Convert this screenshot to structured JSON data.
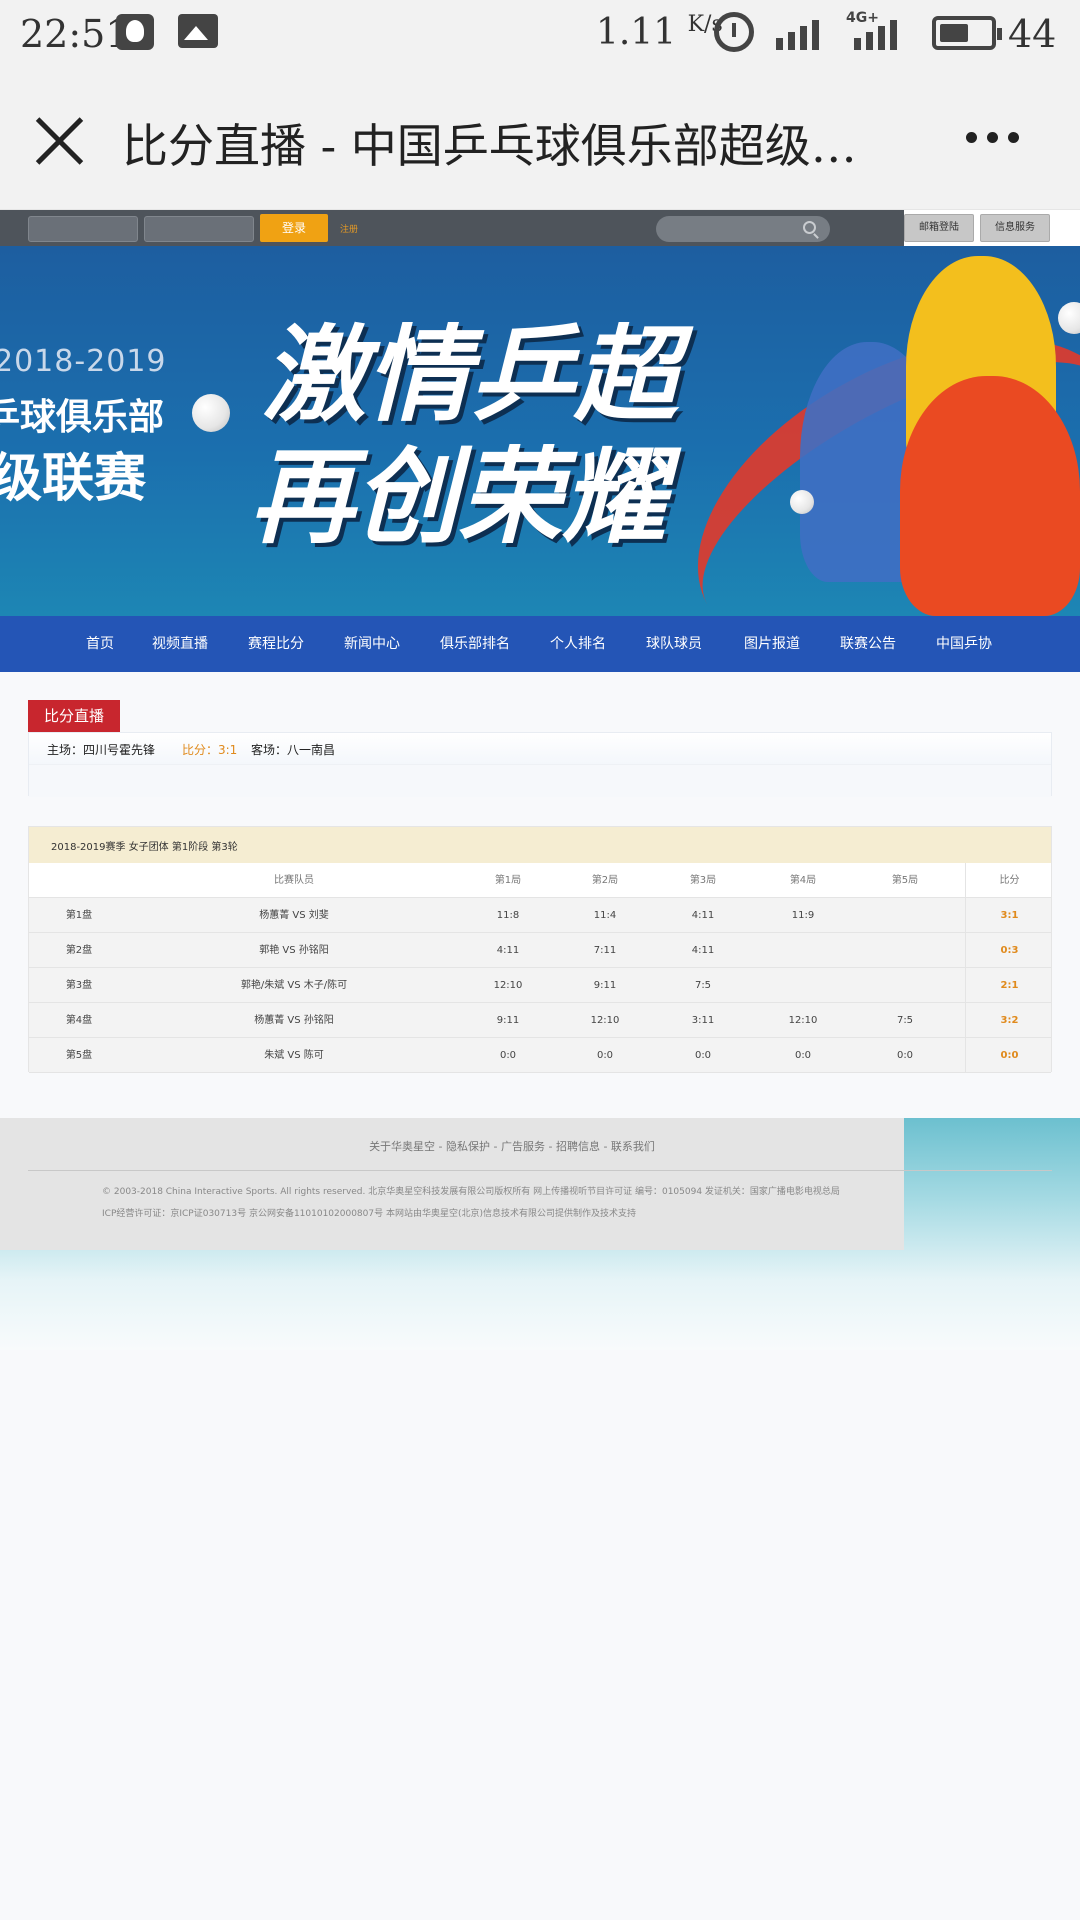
{
  "status_bar": {
    "time": "22:51",
    "net_speed": "1.11",
    "net_unit": "K/s",
    "network_type": "4G+",
    "battery": "44",
    "icons": [
      "qq-icon",
      "gallery-icon",
      "alarm-icon",
      "signal-icon",
      "signal-4g-icon",
      "battery-icon"
    ]
  },
  "browser": {
    "title": "比分直播 - 中国乒乓球俱乐部超级联赛",
    "close_icon": "close-icon",
    "more_icon": "more-icon"
  },
  "topnav": {
    "login_label": "登录",
    "register_label": "注册",
    "mail_label": "邮箱登陆",
    "info_label": "信息服务"
  },
  "banner": {
    "year": "2018-2019",
    "club_text": "乒球俱乐部",
    "league_text": "级联赛",
    "slogan_line1": "激情乒超",
    "slogan_line2": "再创荣耀"
  },
  "main_nav": [
    "首页",
    "视频直播",
    "赛程比分",
    "新闻中心",
    "俱乐部排名",
    "个人排名",
    "球队球员",
    "图片报道",
    "联赛公告",
    "中国乒协"
  ],
  "section": {
    "tag": "比分直播",
    "home": "主场：四川号霍先锋",
    "score": "比分：3:1",
    "away": "客场：八一南昌"
  },
  "scorecard": {
    "title": "2018-2019赛季 女子团体 第1阶段 第3轮",
    "headers": [
      "",
      "比赛队员",
      "第1局",
      "第2局",
      "第3局",
      "第4局",
      "第5局",
      "比分"
    ],
    "rows": [
      [
        "第1盘",
        "杨蕙菁 VS 刘斐",
        "11:8",
        "11:4",
        "4:11",
        "11:9",
        "",
        "3:1"
      ],
      [
        "第2盘",
        "郭艳 VS 孙铭阳",
        "4:11",
        "7:11",
        "4:11",
        "",
        "",
        "0:3"
      ],
      [
        "第3盘",
        "郭艳/朱斌 VS 木子/陈可",
        "12:10",
        "9:11",
        "7:5",
        "",
        "",
        "2:1"
      ],
      [
        "第4盘",
        "杨蕙菁 VS 孙铭阳",
        "9:11",
        "12:10",
        "3:11",
        "12:10",
        "7:5",
        "3:2"
      ],
      [
        "第5盘",
        "朱斌 VS 陈可",
        "0:0",
        "0:0",
        "0:0",
        "0:0",
        "0:0",
        "0:0"
      ]
    ]
  },
  "footer": {
    "links": "关于华奥星空 - 隐私保护 - 广告服务 - 招聘信息 - 联系我们",
    "copyright": "© 2003-2018 China Interactive Sports. All rights reserved. 北京华奥星空科技发展有限公司版权所有 网上传播视听节目许可证 编号：0105094 发证机关：国家广播电影电视总局",
    "icp": "ICP经营许可证：京ICP证030713号  京公网安备11010102000807号 本网站由华奥星空(北京)信息技术有限公司提供制作及技术支持"
  },
  "colors": {
    "accent_red": "#c8262e",
    "accent_orange": "#e08a1c",
    "nav_blue": "#2455b6"
  }
}
